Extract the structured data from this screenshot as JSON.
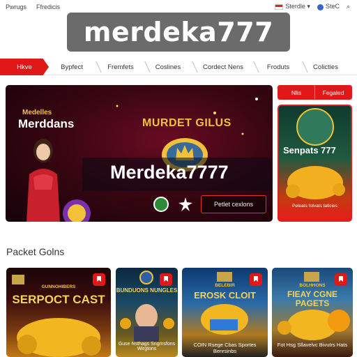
{
  "topbar": {
    "left_items": [
      "Pwrugs",
      "Ffredicis"
    ],
    "right_items": [
      "Sterdle",
      "SteC"
    ]
  },
  "logo": {
    "text": "merdeka777"
  },
  "nav": {
    "tabs": [
      "Hkve",
      "Bypfect",
      "Fremfets",
      "Coslines",
      "Cordect Nens",
      "Froduts",
      "Colicties"
    ]
  },
  "hero": {
    "brand_top": "Medelles",
    "brand": "Merddans",
    "tagline": "MURDET GILUS",
    "headline": "Merdeka7777",
    "button": "Petlet cexlons"
  },
  "side": {
    "tabs": [
      "Nlis",
      "Fegaled"
    ],
    "card_title": "Senpats 777",
    "card_caption": "Peleats fotvats tatlcies"
  },
  "section": {
    "title": "Packet Golns"
  },
  "games": [
    {
      "title": "SERPOCT CAST",
      "subtitle": "GUNNOHIBERS",
      "desc": ""
    },
    {
      "title": "BUNDUONS NUNGLES",
      "subtitle": "",
      "desc": "Guse Nsthags Sngmsfons Wirgtons"
    },
    {
      "title": "EROSK CLOIT",
      "subtitle": "BELEBIR",
      "desc": "COIN Rsege Cbas Sportes Benrsinbs"
    },
    {
      "title": "FIEAY CGNE PAGETS",
      "subtitle": "BOLHHONS",
      "desc": "Fot Hsg Sllavelvc Bivutrs Hats"
    }
  ],
  "colors": {
    "accent": "#e01818",
    "logo_bg": "#6b6b6b",
    "gold": "#f2c13a"
  }
}
